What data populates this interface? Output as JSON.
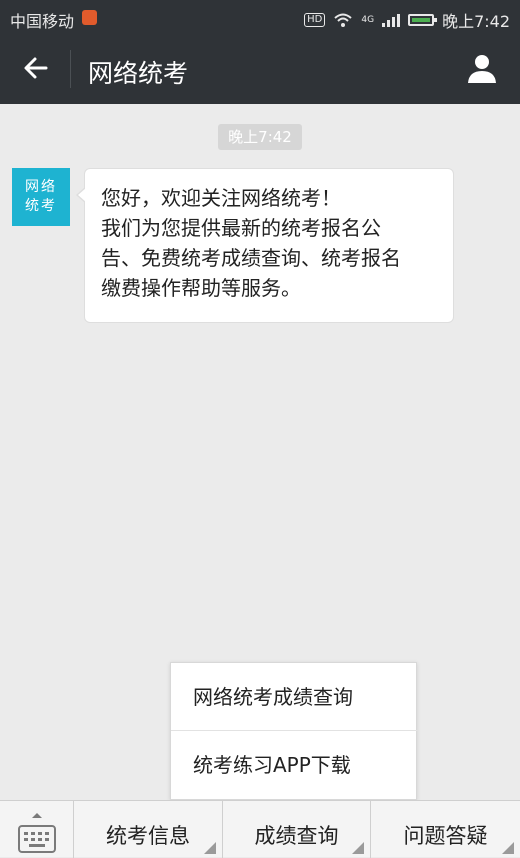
{
  "status_bar": {
    "carrier": "中国移动",
    "hd_label": "HD",
    "network": "4G",
    "time": "晚上7:42"
  },
  "header": {
    "title": "网络统考"
  },
  "chat": {
    "timestamp": "晚上7:42",
    "avatar_text_line1": "网络",
    "avatar_text_line2": "统考",
    "message_lines": [
      "您好，欢迎关注网络统考！",
      "我们为您提供最新的统考报名公",
      "告、免费统考成绩查询、统考报名",
      "缴费操作帮助等服务。"
    ]
  },
  "popup_menu": {
    "items": [
      "网络统考成绩查询",
      "统考练习APP下载"
    ]
  },
  "bottom_menu": {
    "tabs": [
      "统考信息",
      "成绩查询",
      "问题答疑"
    ]
  },
  "colors": {
    "topbar": "#2f3337",
    "background": "#ebebeb",
    "avatar": "#1eb3d1"
  }
}
